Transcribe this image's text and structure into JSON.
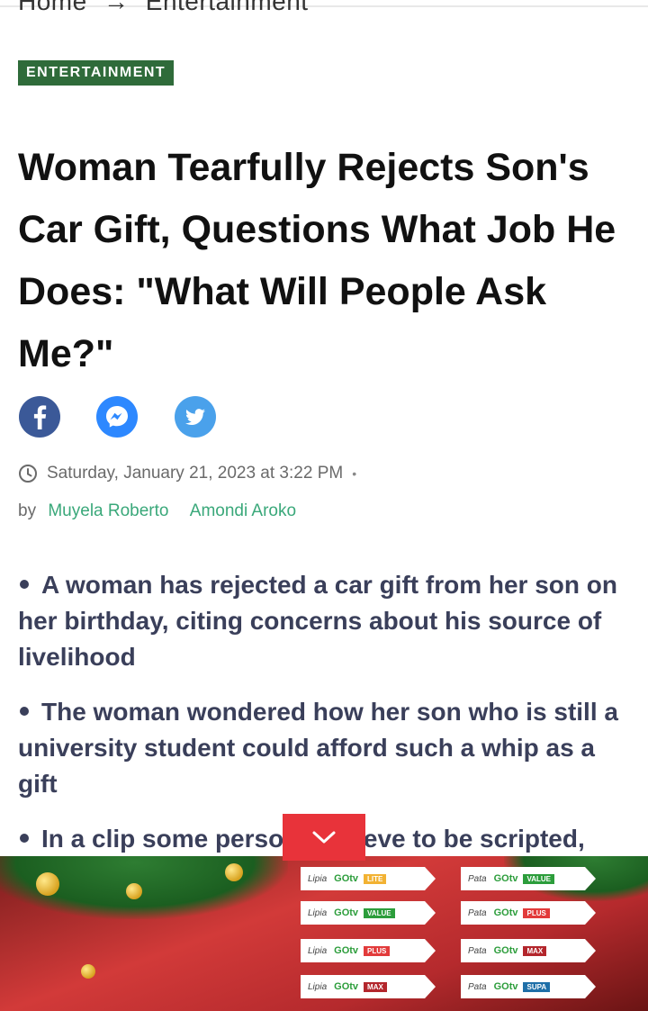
{
  "breadcrumb": {
    "home": "Home",
    "arrow": "→",
    "section": "Entertainment"
  },
  "category_tag": "ENTERTAINMENT",
  "headline": "Woman Tearfully Rejects Son's Car Gift, Questions What Job He Does: \"What Will People Ask Me?\"",
  "share": {
    "facebook_icon": "facebook-icon",
    "messenger_icon": "messenger-icon",
    "twitter_icon": "twitter-icon"
  },
  "meta": {
    "date": "Saturday, January 21, 2023 at 3:22 PM",
    "separator": "•"
  },
  "byline": {
    "by": "by",
    "authors": [
      "Muyela Roberto",
      "Amondi Aroko"
    ]
  },
  "bullets": [
    "A woman has rejected a car gift from her son on her birthday, citing concerns about his source of livelihood",
    "The woman wondered how her son who is still a university student could afford such a whip as a gift",
    "In a clip some persons believe to be scripted,"
  ],
  "ad": {
    "left_column": [
      {
        "pre": "Lipia",
        "brand": "GOtv",
        "tier": "LITE",
        "tier_color": "#f2b233"
      },
      {
        "pre": "Lipia",
        "brand": "GOtv",
        "tier": "VALUE",
        "tier_color": "#2c9d3b"
      },
      {
        "pre": "Lipia",
        "brand": "GOtv",
        "tier": "PLUS",
        "tier_color": "#e23b3b"
      },
      {
        "pre": "Lipia",
        "brand": "GOtv",
        "tier": "MAX",
        "tier_color": "#b3262c"
      }
    ],
    "right_column": [
      {
        "pre": "Pata",
        "brand": "GOtv",
        "tier": "VALUE",
        "tier_color": "#2c9d3b"
      },
      {
        "pre": "Pata",
        "brand": "GOtv",
        "tier": "PLUS",
        "tier_color": "#e23b3b"
      },
      {
        "pre": "Pata",
        "brand": "GOtv",
        "tier": "MAX",
        "tier_color": "#b3262c"
      },
      {
        "pre": "Pata",
        "brand": "GOtv",
        "tier": "SUPA",
        "tier_color": "#1f6fa8"
      }
    ]
  },
  "colors": {
    "tag_bg": "#2f6b3a",
    "author_link": "#3aa87a",
    "bullet_text": "#3a3f5a",
    "facebook": "#3b5998",
    "messenger": "#2d88ff",
    "twitter": "#4aa1eb",
    "collapse_button": "#e8333a"
  }
}
